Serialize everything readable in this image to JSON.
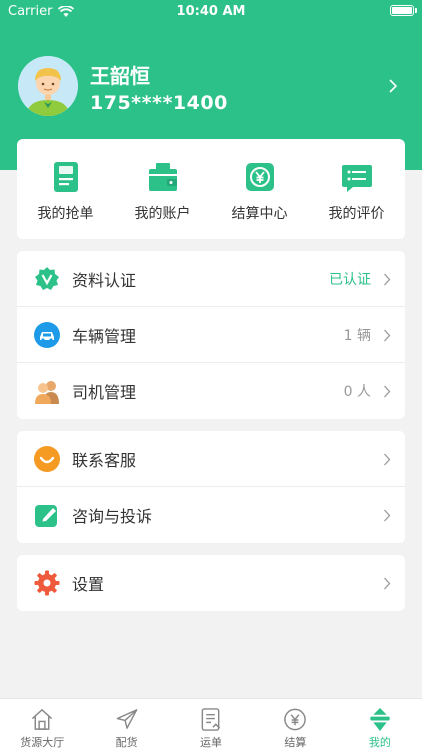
{
  "status_bar": {
    "carrier": "Carrier",
    "time": "10:40 AM"
  },
  "profile": {
    "name": "王韶恒",
    "phone": "175****1400"
  },
  "quick_actions": [
    {
      "label": "我的抢单",
      "icon": "document-icon"
    },
    {
      "label": "我的账户",
      "icon": "wallet-icon"
    },
    {
      "label": "结算中心",
      "icon": "yuan-exchange-icon"
    },
    {
      "label": "我的评价",
      "icon": "comment-icon"
    }
  ],
  "group1": [
    {
      "label": "资料认证",
      "value": "已认证",
      "icon": "verified-v-icon"
    },
    {
      "label": "车辆管理",
      "value": "1 辆",
      "icon": "car-icon"
    },
    {
      "label": "司机管理",
      "value": "0 人",
      "icon": "people-icon"
    }
  ],
  "group2": [
    {
      "label": "联系客服",
      "icon": "customer-service-icon"
    },
    {
      "label": "咨询与投诉",
      "icon": "edit-icon"
    }
  ],
  "group3": [
    {
      "label": "设置",
      "icon": "gear-icon"
    }
  ],
  "tabs": [
    {
      "label": "货源大厅",
      "icon": "home-icon",
      "active": false
    },
    {
      "label": "配货",
      "icon": "send-icon",
      "active": false
    },
    {
      "label": "运单",
      "icon": "waybill-icon",
      "active": false
    },
    {
      "label": "结算",
      "icon": "yuan-icon",
      "active": false
    },
    {
      "label": "我的",
      "icon": "profile-icon",
      "active": true
    }
  ],
  "colors": {
    "primary": "#2dc18a",
    "background": "#f2f2f2"
  }
}
